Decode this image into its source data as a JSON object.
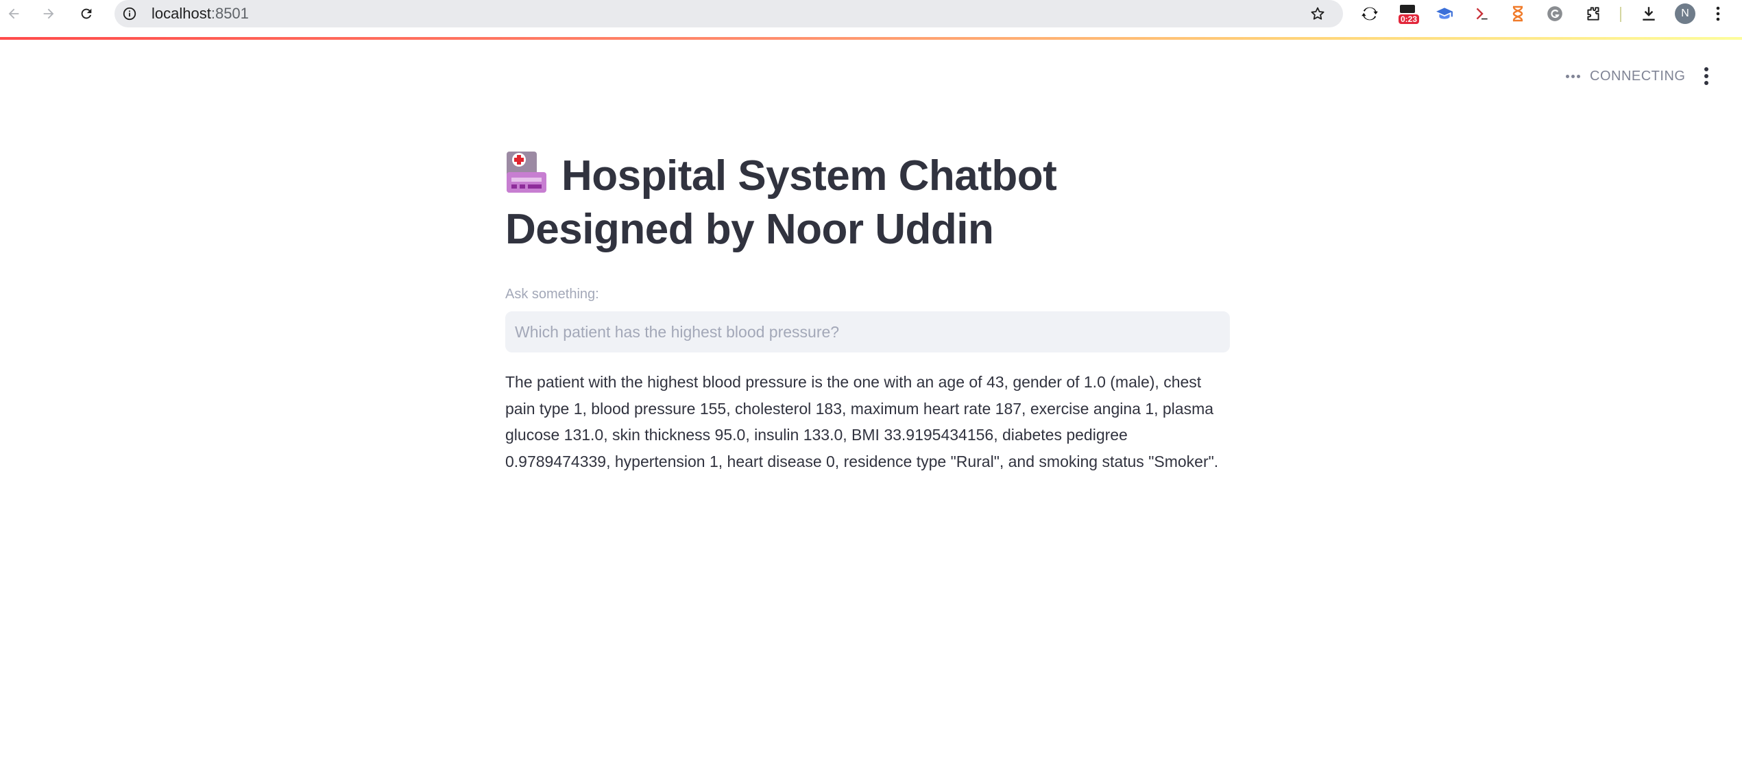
{
  "browser": {
    "url_host": "localhost",
    "url_port": ":8501",
    "timer_badge": "0:23",
    "profile_initial": "N",
    "icons": {
      "back": "arrow-left-icon",
      "forward": "arrow-right-icon",
      "reload": "reload-icon",
      "site_info": "info-icon",
      "bookmark": "star-icon",
      "extensions": [
        "sync-extension-icon",
        "timer-extension-icon",
        "graduation-cap-extension-icon",
        "terminal-extension-icon",
        "hourglass-extension-icon",
        "grammarly-extension-icon",
        "puzzle-extensions-icon"
      ],
      "download": "download-icon",
      "menu": "kebab-menu-icon"
    }
  },
  "app": {
    "status": "CONNECTING",
    "title_line1": "Hospital System Chatbot",
    "title_line2": "Designed by Noor Uddin",
    "title_icon": "hospital-icon",
    "input_label": "Ask something:",
    "input_placeholder": "Which patient has the highest blood pressure?",
    "input_value": "",
    "answer": "The patient with the highest blood pressure is the one with an age of 43, gender of 1.0 (male), chest pain type 1, blood pressure 155, cholesterol 183, maximum heart rate 187, exercise angina 1, plasma glucose 131.0, skin thickness 95.0, insulin 133.0, BMI 33.9195434156, diabetes pedigree 0.9789474339, hypertension 1, heart disease 0, residence type \"Rural\", and smoking status \"Smoker\"."
  },
  "colors": {
    "text": "#31333f",
    "muted": "#a3a8b8",
    "input_bg": "#f0f2f6",
    "accent": "#ff4b4b"
  }
}
